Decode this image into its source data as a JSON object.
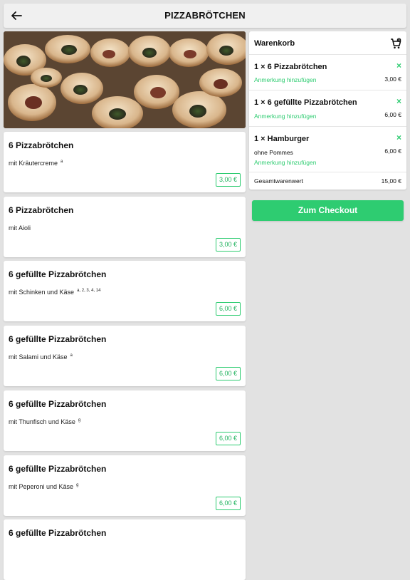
{
  "header": {
    "title": "PIZZABRÖTCHEN",
    "back_icon": "arrow-left-icon"
  },
  "products": [
    {
      "name": "6 Pizzabrötchen",
      "desc": "mit Kräutercreme",
      "allergens": "a",
      "price": "3,00 €"
    },
    {
      "name": "6 Pizzabrötchen",
      "desc": "mit Aioli",
      "allergens": "",
      "price": "3,00 €"
    },
    {
      "name": "6 gefüllte Pizzabrötchen",
      "desc": "mit Schinken und Käse",
      "allergens": "a, 2, 3, 4, 14",
      "price": "6,00 €"
    },
    {
      "name": "6 gefüllte Pizzabrötchen",
      "desc": "mit Salami und Käse",
      "allergens": "a",
      "price": "6,00 €"
    },
    {
      "name": "6 gefüllte Pizzabrötchen",
      "desc": "mit Thunfisch und Käse",
      "allergens": "g",
      "price": "6,00 €"
    },
    {
      "name": "6 gefüllte Pizzabrötchen",
      "desc": "mit Peperoni und Käse",
      "allergens": "g",
      "price": "6,00 €"
    },
    {
      "name": "6 gefüllte Pizzabrötchen",
      "desc": "",
      "allergens": "",
      "price": ""
    }
  ],
  "cart": {
    "title": "Warenkorb",
    "icon": "cart-icon",
    "items": [
      {
        "name": "1 × 6 Pizzabrötchen",
        "option": "",
        "note": "Anmerkung hinzufügen",
        "price": "3,00 €"
      },
      {
        "name": "1 × 6 gefüllte Pizzabrötchen",
        "option": "",
        "note": "Anmerkung hinzufügen",
        "price": "6,00 €"
      },
      {
        "name": "1 × Hamburger",
        "option": "ohne Pommes",
        "note": "Anmerkung hinzufügen",
        "price": "6,00 €"
      }
    ],
    "remove_symbol": "×",
    "total_label": "Gesamtwarenwert",
    "total_value": "15,00 €"
  },
  "checkout": {
    "label": "Zum Checkout"
  },
  "colors": {
    "accent": "#2ecc71",
    "background": "#e2e2e2"
  }
}
